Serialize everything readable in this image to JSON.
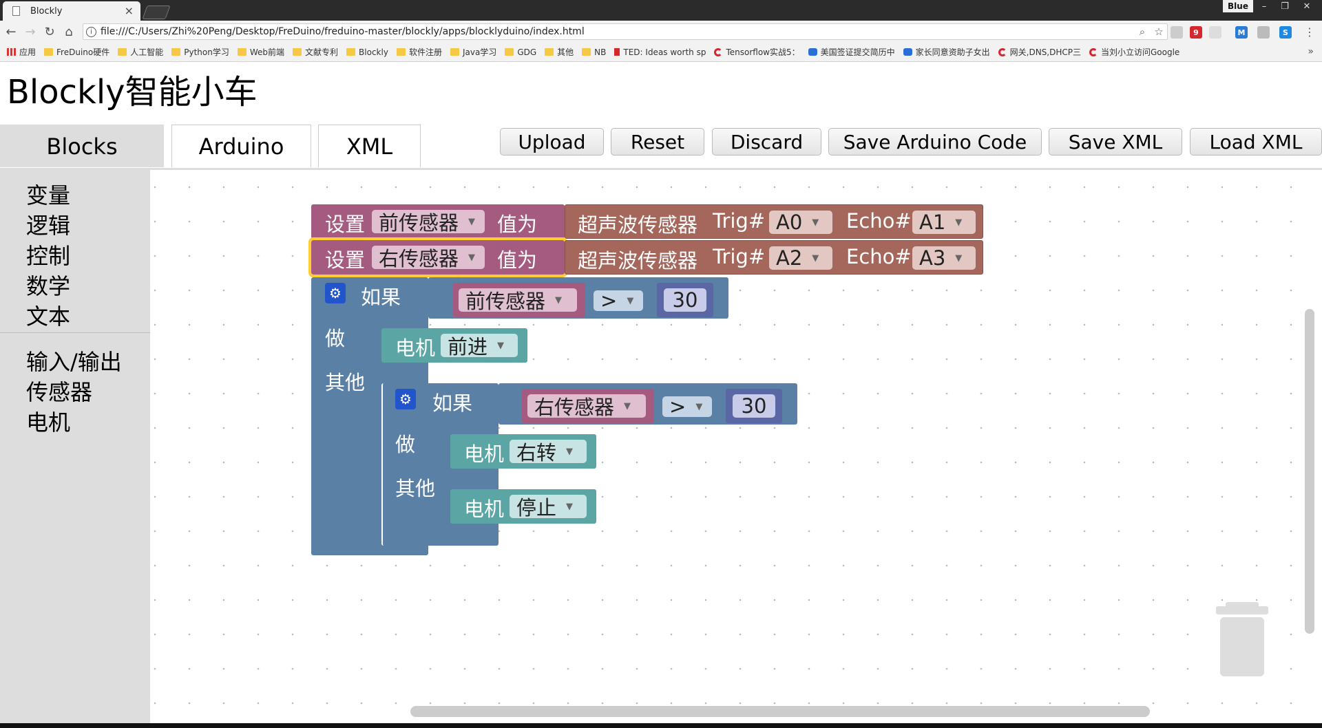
{
  "browser": {
    "tab_title": "Blockly",
    "tab_close": "×",
    "profile": "Blue",
    "window_controls": [
      "–",
      "❐",
      "✕"
    ],
    "url": "file:///C:/Users/Zhi%20Peng/Desktop/FreDuino/freduino-master/blockly/apps/blocklyduino/index.html",
    "icons": [
      "back-icon",
      "forward-icon",
      "reload-icon",
      "home-icon",
      "info-icon",
      "zoom-icon",
      "star-icon"
    ],
    "extensions": [
      "9",
      "M",
      "S"
    ]
  },
  "bookmarks": [
    {
      "label": "应用",
      "icon": "apps"
    },
    {
      "label": "FreDuino硬件",
      "icon": "folder"
    },
    {
      "label": "人工智能",
      "icon": "folder"
    },
    {
      "label": "Python学习",
      "icon": "folder"
    },
    {
      "label": "Web前端",
      "icon": "folder"
    },
    {
      "label": "文献专利",
      "icon": "folder"
    },
    {
      "label": "Blockly",
      "icon": "folder"
    },
    {
      "label": "软件注册",
      "icon": "folder"
    },
    {
      "label": "Java学习",
      "icon": "folder"
    },
    {
      "label": "GDG",
      "icon": "folder"
    },
    {
      "label": "其他",
      "icon": "folder"
    },
    {
      "label": "NB",
      "icon": "folder"
    },
    {
      "label": "TED: Ideas worth sp",
      "icon": "ted"
    },
    {
      "label": "Tensorflow实战5：",
      "icon": "csdn"
    },
    {
      "label": "美国签证提交简历中",
      "icon": "paw"
    },
    {
      "label": "家长同意资助子女出",
      "icon": "paw"
    },
    {
      "label": "网关,DNS,DHCP三",
      "icon": "csdn"
    },
    {
      "label": "当刘小立访问Google",
      "icon": "csdn"
    }
  ],
  "bookmarks_more": "»",
  "page": {
    "title": "Blockly智能小车",
    "tabs": [
      "Blocks",
      "Arduino",
      "XML"
    ],
    "buttons": [
      "Upload",
      "Reset",
      "Discard",
      "Save Arduino Code",
      "Save XML",
      "Load XML"
    ]
  },
  "toolbox": {
    "group1": [
      "变量",
      "逻辑",
      "控制",
      "数学",
      "文本"
    ],
    "group2": [
      "输入/输出",
      "传感器",
      "电机"
    ]
  },
  "blocks": {
    "set_label": "设置",
    "value_label": "值为",
    "ultrasonic": "超声波传感器",
    "trig": "Trig#",
    "echo": "Echo#",
    "set1": {
      "var": "前传感器",
      "trig": "A0",
      "echo": "A1"
    },
    "set2": {
      "var": "右传感器",
      "trig": "A2",
      "echo": "A3"
    },
    "if_label": "如果",
    "do_label": "做",
    "else_label": "其他",
    "motor": "电机",
    "if1": {
      "var": "前传感器",
      "op": ">",
      "num": "30",
      "action": "前进"
    },
    "if2": {
      "var": "右传感器",
      "op": ">",
      "num": "30",
      "action": "右转",
      "else_action": "停止"
    }
  },
  "colors": {
    "variable_block": "#a55b80",
    "sensor_block": "#a5675b",
    "logic_block": "#5b80a5",
    "motor_block": "#5ba5a5",
    "math_block": "#5b67a5",
    "selected_outline": "#fc3"
  }
}
